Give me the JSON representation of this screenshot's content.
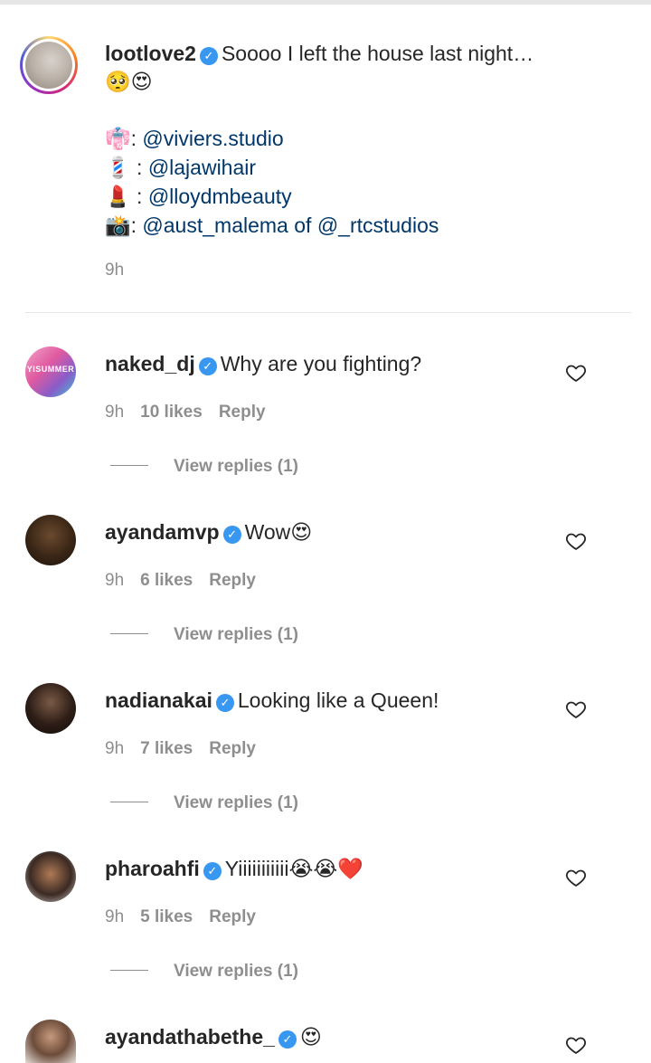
{
  "post": {
    "author": "lootlove2",
    "verified_mark": "✓",
    "caption_line1": "Soooo I left the house last night…",
    "caption_emojis": "🥺😍",
    "credits": [
      {
        "emoji": "👘",
        "separator": ": ",
        "handle": "@viviers.studio",
        "suffix": "",
        "handle2": ""
      },
      {
        "emoji": "💈",
        "separator": " : ",
        "handle": "@lajawihair",
        "suffix": "",
        "handle2": ""
      },
      {
        "emoji": "💄",
        "separator": " : ",
        "handle": "@lloydmbeauty",
        "suffix": "",
        "handle2": ""
      },
      {
        "emoji": "📸",
        "separator": ": ",
        "handle": "@aust_malema",
        "suffix": " of ",
        "handle2": "@_rtcstudios"
      }
    ],
    "time": "9h"
  },
  "comments": [
    {
      "username": "naked_dj",
      "text": "Why are you fighting?",
      "avatar_label": "YISUMMER",
      "time": "9h",
      "likes": "10 likes",
      "reply": "Reply",
      "view_replies": "View replies (1)"
    },
    {
      "username": "ayandamvp",
      "text": "Wow😍",
      "avatar_label": "",
      "time": "9h",
      "likes": "6 likes",
      "reply": "Reply",
      "view_replies": "View replies (1)"
    },
    {
      "username": "nadianakai",
      "text": "Looking like a Queen!",
      "avatar_label": "",
      "time": "9h",
      "likes": "7 likes",
      "reply": "Reply",
      "view_replies": "View replies (1)"
    },
    {
      "username": "pharoahfi",
      "text": "Yiiiiiiiiiii😭😭❤️",
      "avatar_label": "",
      "time": "9h",
      "likes": "5 likes",
      "reply": "Reply",
      "view_replies": "View replies (1)"
    },
    {
      "username": "ayandathabethe_",
      "text": "😍",
      "avatar_label": "",
      "time": "",
      "likes": "",
      "reply": "",
      "view_replies": ""
    }
  ],
  "colors": {
    "verified": "#3897f0",
    "mention": "#00376b",
    "secondary_text": "#8e8e8e"
  },
  "icons": {
    "like": "heart-outline-icon",
    "verified": "verified-badge-icon"
  }
}
